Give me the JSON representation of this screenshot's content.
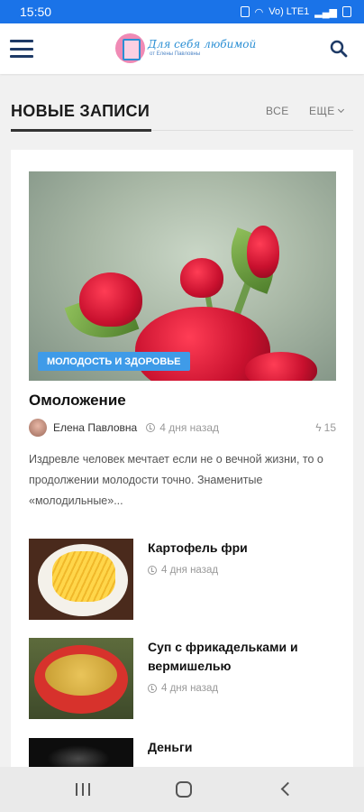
{
  "status_bar": {
    "time": "15:50",
    "network": "Vo) LTE1"
  },
  "header": {
    "logo_title": "Для себя любимой",
    "logo_subtitle": "от Елены Павловны",
    "menu_icon": "hamburger-icon",
    "search_icon": "search-icon"
  },
  "section": {
    "title": "НОВЫЕ ЗАПИСИ",
    "all_label": "ВСЕ",
    "more_label": "ЕЩЕ"
  },
  "featured": {
    "category": "МОЛОДОСТЬ И ЗДОРОВЬЕ",
    "title": "Омоложение",
    "author": "Елена Павловна",
    "time_ago": "4 дня назад",
    "views": "15",
    "excerpt": "Издревле человек мечтает если не о вечной жизни, то о продолжении молодости точно. Знаменитые «молодильные»..."
  },
  "posts": [
    {
      "title": "Картофель фри",
      "time_ago": "4 дня назад"
    },
    {
      "title": "Суп с фрикадельками и вермишелью",
      "time_ago": "4 дня назад"
    },
    {
      "title": "Деньги"
    }
  ],
  "colors": {
    "status_bar": "#1a73e8",
    "badge": "#3f9be8",
    "logo": "#2b8fd4"
  }
}
